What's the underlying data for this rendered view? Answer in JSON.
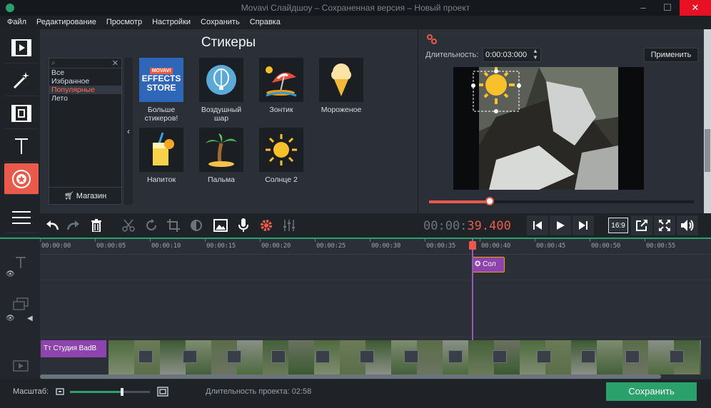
{
  "window": {
    "title": "Movavi Слайдшоу – Сохраненная версия – Новый проект"
  },
  "menu": [
    "Файл",
    "Редактирование",
    "Просмотр",
    "Настройки",
    "Сохранить",
    "Справка"
  ],
  "stickers": {
    "title": "Стикеры",
    "categories": [
      "Все",
      "Избранное",
      "Популярные",
      "Лето"
    ],
    "selected_category": "Популярные",
    "shop_label": "Магазин",
    "items": [
      {
        "label": "Больше стикеров!",
        "brand": "MOVAVI",
        "brand_text": "EFFECTS STORE"
      },
      {
        "label": "Воздушный шар"
      },
      {
        "label": "Зонтик"
      },
      {
        "label": "Мороженое"
      },
      {
        "label": "Напиток"
      },
      {
        "label": "Пальма"
      },
      {
        "label": "Солнце 2"
      }
    ]
  },
  "preview": {
    "duration_label": "Длительность:",
    "duration_value": "0:00:03:000",
    "apply_label": "Применить",
    "progress": 0.23
  },
  "player": {
    "timecode_dim": "00:00:",
    "timecode_hot": "39.400",
    "aspect": "16:9"
  },
  "timeline": {
    "ticks": [
      "00:00:00",
      "00:00:05",
      "00:00:10",
      "00:00:15",
      "00:00:20",
      "00:00:25",
      "00:00:30",
      "00:00:35",
      "00:00:40",
      "00:00:45",
      "00:00:50",
      "00:00:55"
    ],
    "sticker_clip_label": "Сол",
    "title_clip_label": "Студия BadB"
  },
  "status": {
    "scale_label": "Масштаб:",
    "zoom": 0.65,
    "project_duration": "Длительность проекта: 02:58",
    "save_label": "Сохранить"
  },
  "colors": {
    "accent": "#ea5a4a",
    "green": "#2aa06a",
    "purple": "#8e44ad"
  }
}
